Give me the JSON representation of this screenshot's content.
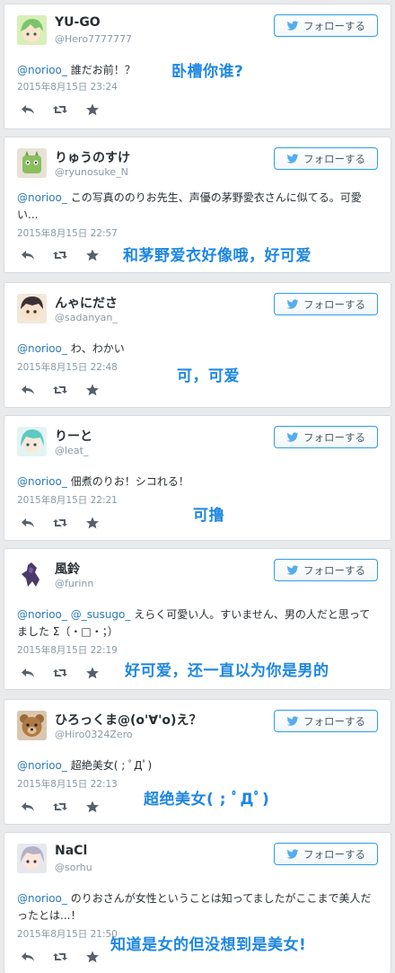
{
  "follow_label": "フォローする",
  "accent_color": "#2c9fe8",
  "tweets": [
    {
      "name": "YU-GO",
      "handle": "@Hero7777777",
      "mention": "@norioo_",
      "text": " 誰だお前！？",
      "time": "2015年8月15日 23:24",
      "caption": "卧槽你谁?",
      "avatar": "anime-avatar-green-hair"
    },
    {
      "name": "りゅうのすけ",
      "handle": "@ryunosuke_N",
      "mention": "@norioo_",
      "text": " この写真ののりお先生、声優の茅野愛衣さんに似てる。可愛い...",
      "time": "2015年8月15日 22:57",
      "caption": "和茅野爱衣好像哦，好可爱",
      "avatar": "green-creature-avatar"
    },
    {
      "name": "んゃにださ",
      "handle": "@sadanyan_",
      "mention": "@norioo_",
      "text": " わ、わかい",
      "time": "2015年8月15日 22:48",
      "caption": "可，可爱",
      "avatar": "anime-avatar-dark-hair"
    },
    {
      "name": "りーと",
      "handle": "@leat_",
      "mention": "@norioo_",
      "text": " 佃煮のりお！シコれる！",
      "time": "2015年8月15日 22:21",
      "caption": "可撸",
      "avatar": "anime-avatar-teal-hair"
    },
    {
      "name": "風鈴",
      "handle": "@furinn",
      "mention": "@norioo_ @_susugo_",
      "text": " えらく可愛い人。すいません、男の人だと思ってました Σ（・□・；）",
      "time": "2015年8月15日 22:19",
      "caption": "好可爱，还一直以为你是男的",
      "avatar": "purple-robot-avatar"
    },
    {
      "name": "ひろっくま@(o'∀'o)え？",
      "handle": "@Hiro0324Zero",
      "mention": "@norioo_",
      "text": " 超絶美女( ; ﾟДﾟ)",
      "time": "2015年8月15日 22:13",
      "caption": "超绝美女( ; ﾟДﾟ)",
      "avatar": "teddy-bear-avatar"
    },
    {
      "name": "NaCl",
      "handle": "@sorhu",
      "mention": "@norioo_",
      "text": " のりおさんが女性ということは知ってましたがここまで美人だったとは...！",
      "time": "2015年8月15日 21:50",
      "caption": "知道是女的但没想到是美女!",
      "avatar": "anime-avatar-light-hair"
    }
  ]
}
